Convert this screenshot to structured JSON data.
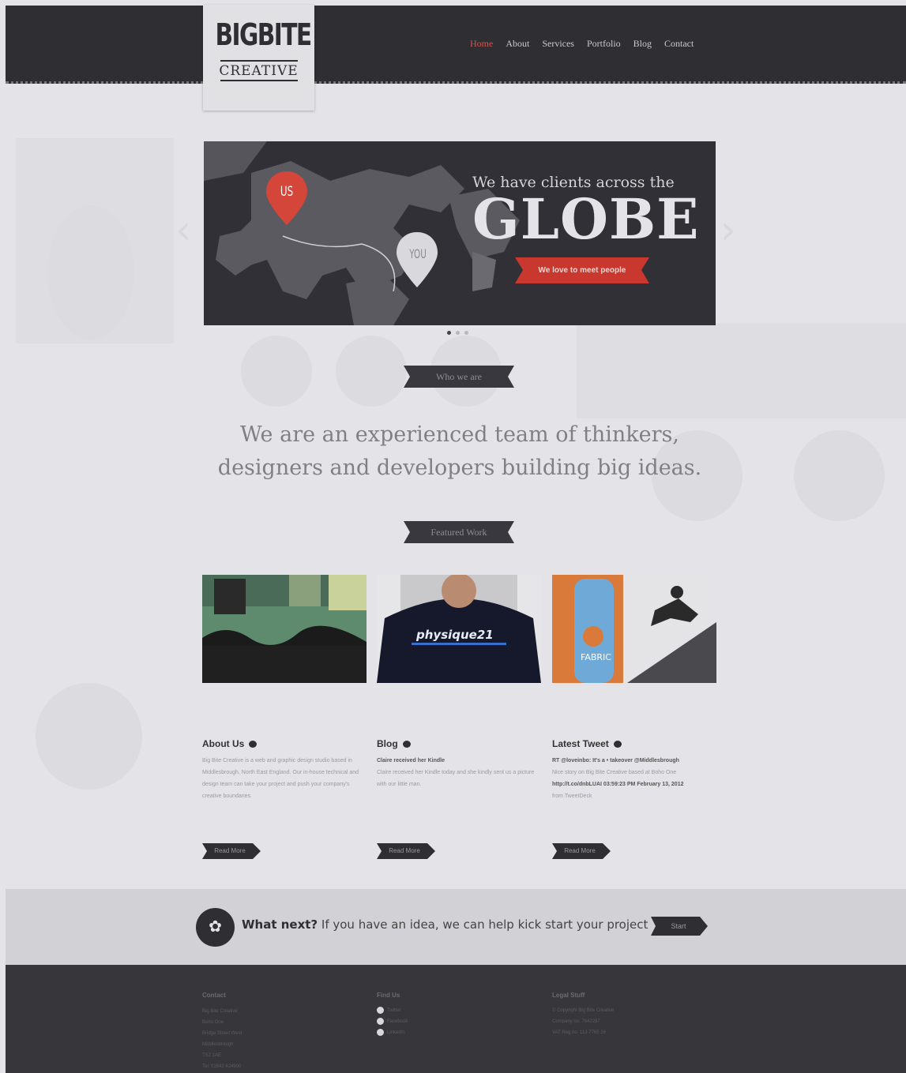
{
  "brand": {
    "logo_main": "BIGBITE",
    "logo_sub": "CREATIVE"
  },
  "nav": [
    "Home",
    "About",
    "Services",
    "Portfolio",
    "Blog",
    "Contact"
  ],
  "slider": {
    "headline_small": "We have clients across the",
    "headline_big": "GLOBE",
    "ribbon": "We love to meet people",
    "pin_us": "US",
    "pin_you": "YOU",
    "dots": 3,
    "active_dot": 0
  },
  "who": {
    "label": "Who we are",
    "intro_line1": "We are an experienced team of thinkers,",
    "intro_line2": "designers and developers building big ideas."
  },
  "featured": {
    "label": "Featured Work",
    "thumb2_text": "physique21",
    "thumb3_text": "FABRIC"
  },
  "about": {
    "title": "About Us",
    "text": "Big Bite Creative is a web and graphic design studio based in Middlesbrough, North East England. Our in-house technical and design team can take your project and push your company's creative boundaries.",
    "button": "Read More"
  },
  "blog": {
    "title": "Blog",
    "post_title": "Claire received her Kindle",
    "text": "Claire received her Kindle today and she kindly sent us a picture with our little man.",
    "button": "Read More"
  },
  "tweet": {
    "title": "Latest Tweet",
    "line1": "RT @loveinbo: It's a • takeover @Middlesbrough",
    "line2": "Nice story on Big Bite Creative based at Boho One",
    "line3": "http://t.co/dnbLUAI 03:59:23 PM February 13, 2012",
    "line4": "from TweetDeck",
    "button": "Read More"
  },
  "cta": {
    "strong": "What next?",
    "text": " If you have an idea, we can help kick start your project",
    "button": "Start"
  },
  "footer": {
    "contact_title": "Contact",
    "contact_lines": [
      "Big Bite Creative",
      "Boho One",
      "Bridge Street West",
      "Middlesbrough",
      "TS2 1AE",
      "Tel: 01642 424900"
    ],
    "find_title": "Find Us",
    "find_links": [
      "Twitter",
      "Facebook",
      "LinkedIn"
    ],
    "legal_title": "Legal Stuff",
    "legal_lines": [
      "© Copyright Big Bite Creative",
      "Company no. 7642287",
      "VAT Reg no. 113 7765 26"
    ]
  }
}
